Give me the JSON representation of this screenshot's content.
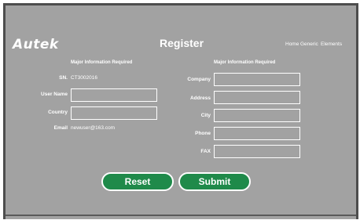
{
  "header": {
    "logo": "Autek",
    "title": "Register",
    "nav": [
      "Home",
      "Generic",
      "Elements"
    ]
  },
  "left": {
    "section_title": "Major Information Required",
    "sn_label": "SN.",
    "sn_value": "CT3002016",
    "username_label": "User Name",
    "username_value": "",
    "country_label": "Country",
    "country_value": "",
    "email_label": "Email",
    "email_value": "newuser@163.com"
  },
  "right": {
    "section_title": "Major Information Required",
    "company_label": "Company",
    "address_label": "Address",
    "city_label": "City",
    "phone_label": "Phone",
    "fax_label": "FAX"
  },
  "actions": {
    "reset_label": "Reset",
    "submit_label": "Submit"
  },
  "colors": {
    "background": "#a2a2a2",
    "border": "#4d4d4d",
    "button": "#1f8a4a"
  }
}
